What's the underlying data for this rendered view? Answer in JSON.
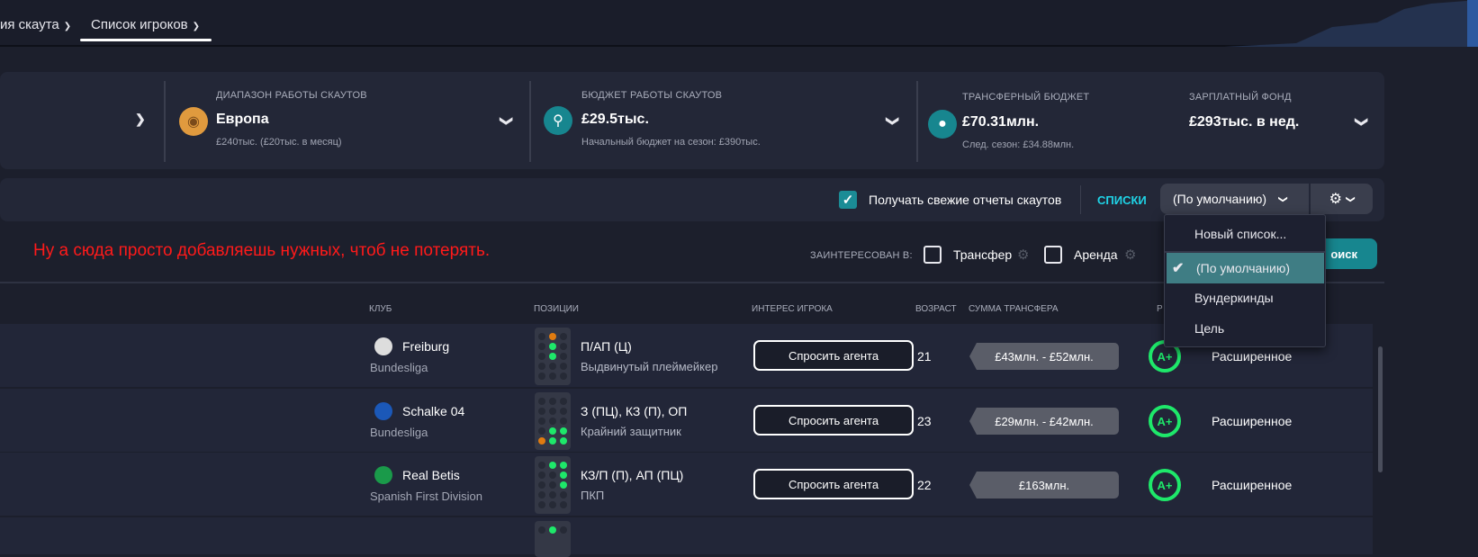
{
  "nav": {
    "tabs": [
      {
        "label": "ия скаута"
      },
      {
        "label": "Список игроков"
      }
    ]
  },
  "finance": {
    "scout_range": {
      "label": "ДИАПАЗОН РАБОТЫ СКАУТОВ",
      "value": "Европа",
      "sub": "£240тыс. (£20тыс. в месяц)"
    },
    "scout_budget": {
      "label": "БЮДЖЕТ РАБОТЫ СКАУТОВ",
      "value": "£29.5тыс.",
      "sub": "Начальный бюджет на сезон: £390тыс."
    },
    "transfer_budget": {
      "label": "ТРАНСФЕРНЫЙ БЮДЖЕТ",
      "value": "£70.31млн.",
      "sub": "След. сезон: £34.88млн."
    },
    "wage": {
      "label": "ЗАРПЛАТНЫЙ ФОНД",
      "value": "£293тыс. в нед."
    }
  },
  "toolbar": {
    "fresh_reports": "Получать свежие отчеты скаутов",
    "lists_label": "СПИСКИ",
    "list_selected": "(По умолчанию)"
  },
  "note": "Ну а сюда просто добавляешь нужных, чтоб не потерять.",
  "filters": {
    "interested_label": "ЗАИНТЕРЕСОВАН В:",
    "transfer": "Трансфер",
    "loan": "Аренда",
    "search": "оиск"
  },
  "menu": {
    "items": [
      "Новый список...",
      "(По умолчанию)",
      "Вундеркинды",
      "Цель"
    ],
    "selected": 1
  },
  "columns": {
    "club": "КЛУБ",
    "positions": "ПОЗИЦИИ",
    "interest": "ИНТЕРЕС ИГРОКА",
    "age": "ВОЗРАСТ",
    "fee": "СУММА ТРАНСФЕРА",
    "rating": "Р"
  },
  "players": [
    {
      "club": "Freiburg",
      "league": "Bundesliga",
      "pos": "П/АП (Ц)",
      "role": "Выдвинутый плеймейкер",
      "interest": "Спросить агента",
      "age": "21",
      "fee": "£43млн. - £52млн.",
      "grade": "A+",
      "report": "Расширенное",
      "dots": [
        [
          0,
          1,
          "o"
        ],
        [
          1,
          1,
          "g"
        ],
        [
          2,
          1,
          "g"
        ]
      ]
    },
    {
      "club": "Schalke 04",
      "league": "Bundesliga",
      "pos": "З (ПЦ), КЗ (П), ОП",
      "role": "Крайний защитник",
      "interest": "Спросить агента",
      "age": "23",
      "fee": "£29млн. - £42млн.",
      "grade": "A+",
      "report": "Расширенное",
      "dots": [
        [
          3,
          1,
          "g"
        ],
        [
          3,
          2,
          "g"
        ],
        [
          4,
          0,
          "o"
        ],
        [
          4,
          1,
          "g"
        ],
        [
          4,
          2,
          "g"
        ]
      ]
    },
    {
      "club": "Real Betis",
      "league": "Spanish First Division",
      "pos": "КЗ/П (П), АП (ПЦ)",
      "role": "ПКП",
      "interest": "Спросить агента",
      "age": "22",
      "fee": "£163млн.",
      "grade": "A+",
      "report": "Расширенное",
      "dots": [
        [
          0,
          1,
          "g"
        ],
        [
          0,
          2,
          "g"
        ],
        [
          1,
          2,
          "g"
        ],
        [
          2,
          2,
          "g"
        ]
      ]
    }
  ],
  "colors": {
    "accent": "#1b8c96",
    "green": "#1ee86a",
    "orange": "#e07b10",
    "lists": "#1fd3e6"
  }
}
